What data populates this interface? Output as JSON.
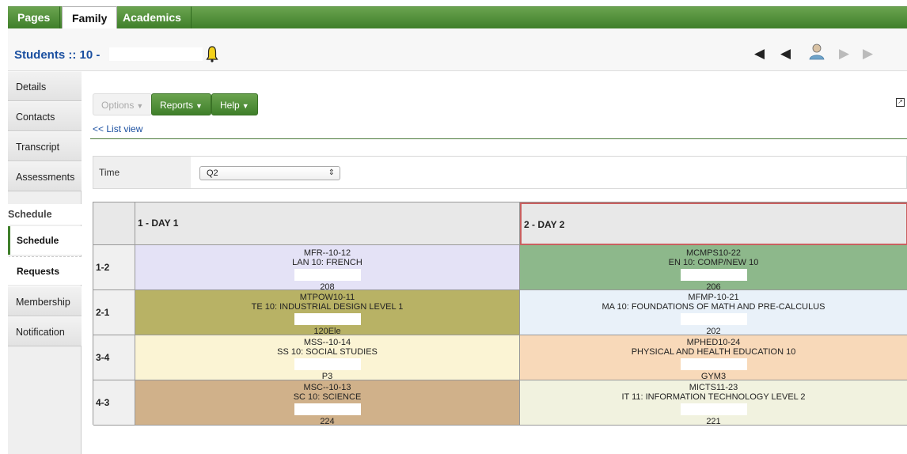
{
  "top_tabs": [
    "Pages",
    "Family",
    "Academics"
  ],
  "header": {
    "title": "Students :: 10 -",
    "name_redacted": true
  },
  "sidebar": {
    "items_top": [
      "Details",
      "Contacts",
      "Transcript",
      "Assessments"
    ],
    "group": "Schedule",
    "sub_items": [
      "Schedule",
      "Requests"
    ],
    "items_bottom": [
      "Membership",
      "Notification"
    ]
  },
  "toolbar": {
    "options": "Options",
    "reports": "Reports",
    "help": "Help",
    "list_view": "<< List view"
  },
  "time_filter": {
    "label": "Time",
    "value": "Q2"
  },
  "schedule": {
    "day_headers": [
      "1 - DAY 1",
      "2 - DAY 2"
    ],
    "rows": [
      {
        "period": "1-2",
        "day1": {
          "code": "MFR--10-12",
          "title": "LAN 10: FRENCH",
          "room": "208",
          "color": "#e4e2f6"
        },
        "day2": {
          "code": "MCMPS10-22",
          "title": "EN 10: COMP/NEW 10",
          "room": "206",
          "color": "#8db88b"
        }
      },
      {
        "period": "2-1",
        "day1": {
          "code": "MTPOW10-11",
          "title": "TE 10: INDUSTRIAL DESIGN LEVEL 1",
          "room": "120Ele",
          "color": "#b8b265"
        },
        "day2": {
          "code": "MFMP-10-21",
          "title": "MA 10: FOUNDATIONS OF MATH AND PRE-CALCULUS",
          "room": "202",
          "color": "#e9f1f9"
        }
      },
      {
        "period": "3-4",
        "day1": {
          "code": "MSS--10-14",
          "title": "SS 10: SOCIAL STUDIES",
          "room": "P3",
          "color": "#fbf4d4"
        },
        "day2": {
          "code": "MPHED10-24",
          "title": "PHYSICAL AND HEALTH EDUCATION 10",
          "room": "GYM3",
          "color": "#f8d9b9"
        }
      },
      {
        "period": "4-3",
        "day1": {
          "code": "MSC--10-13",
          "title": "SC 10: SCIENCE",
          "room": "224",
          "color": "#d0b18a"
        },
        "day2": {
          "code": "MICTS11-23",
          "title": "IT 11: INFORMATION TECHNOLOGY LEVEL 2",
          "room": "221",
          "color": "#f1f2df"
        }
      }
    ]
  }
}
